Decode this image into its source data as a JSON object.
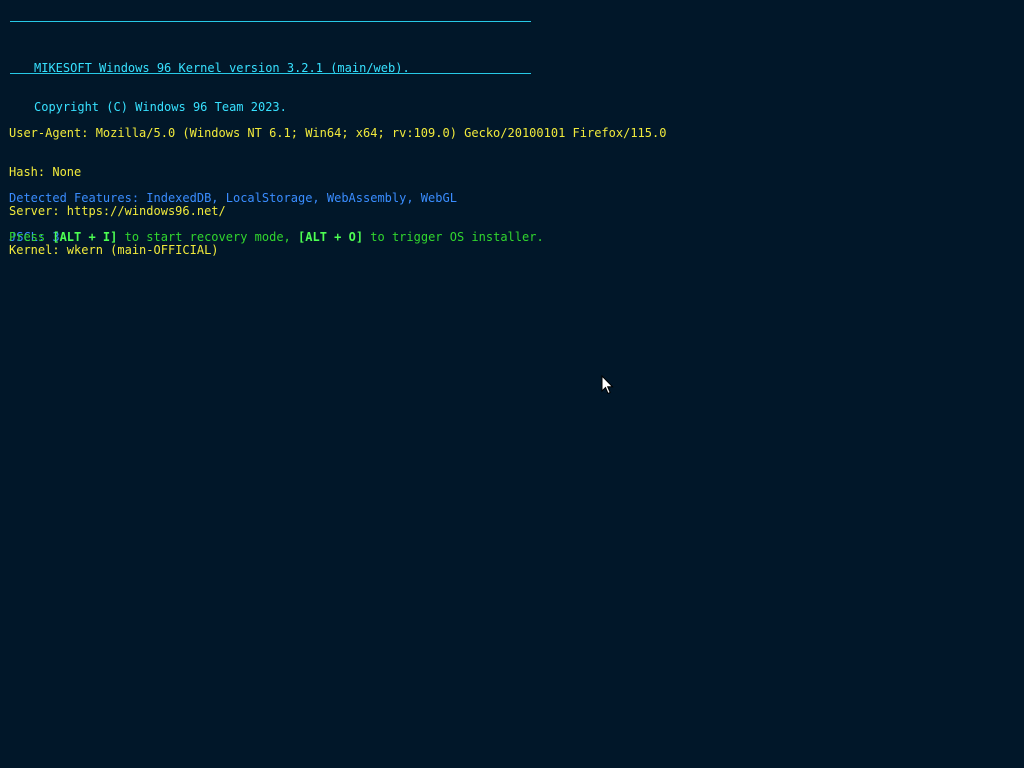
{
  "banner": {
    "line1": "MIKESOFT Windows 96 Kernel version 3.2.1 (main/web).",
    "line2": "Copyright (C) Windows 96 Team 2023."
  },
  "info": {
    "user_agent": "User-Agent: Mozilla/5.0 (Windows NT 6.1; Win64; x64; rv:109.0) Gecko/20100101 Firefox/115.0",
    "hash": "Hash: None",
    "server": "Server: https://windows96.net/",
    "kernel": "Kernel: wkern (main-OFFICIAL)"
  },
  "features": {
    "detected": "Detected Features: IndexedDB, LocalStorage, WebAssembly, WebGL",
    "jscl": "JSCL: 3"
  },
  "prompt": {
    "text1": "Press ",
    "key1": "[ALT + I]",
    "text2": " to start recovery mode, ",
    "key2": "[ALT + O]",
    "text3": " to trigger OS installer."
  },
  "colors": {
    "background": "#011729",
    "banner": "#37e1ff",
    "info": "#f1ea3c",
    "features": "#3a8dff",
    "prompt": "#31d62e"
  },
  "icons": {
    "cursor": "mouse-pointer-icon"
  }
}
